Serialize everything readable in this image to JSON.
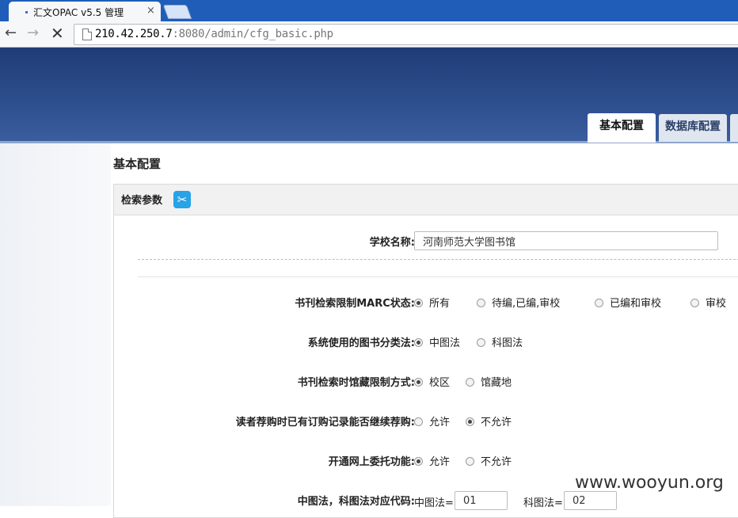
{
  "browser": {
    "tab_title": "汇文OPAC v5.5 管理",
    "close_glyph": "×",
    "nav": {
      "back": "←",
      "forward": "→",
      "stop": "✕"
    },
    "url_host": "210.42.250.7",
    "url_rest": ":8080/admin/cfg_basic.php"
  },
  "page_tabs": {
    "active": "基本配置",
    "inactive": "数据库配置"
  },
  "page_heading": "基本配置",
  "panel": {
    "title": "检索参数",
    "school_name_label": "学校名称:",
    "school_name_value": "河南师范大学图书馆",
    "rows": [
      {
        "label": "书刊检索限制MARC状态:",
        "options": [
          {
            "label": "所有",
            "selected": true
          },
          {
            "label": "待编,已编,审校",
            "selected": false
          },
          {
            "label": "已编和审校",
            "selected": false
          },
          {
            "label": "审校",
            "selected": false
          }
        ]
      },
      {
        "label": "系统使用的图书分类法:",
        "options": [
          {
            "label": "中图法",
            "selected": true
          },
          {
            "label": "科图法",
            "selected": false
          }
        ]
      },
      {
        "label": "书刊检索时馆藏限制方式:",
        "options": [
          {
            "label": "校区",
            "selected": true
          },
          {
            "label": "馆藏地",
            "selected": false
          }
        ]
      },
      {
        "label": "读者荐购时已有订购记录能否继续荐购:",
        "options": [
          {
            "label": "允许",
            "selected": false
          },
          {
            "label": "不允许",
            "selected": true
          }
        ]
      },
      {
        "label": "开通网上委托功能:",
        "options": [
          {
            "label": "允许",
            "selected": true
          },
          {
            "label": "不允许",
            "selected": false
          }
        ]
      }
    ],
    "code_row": {
      "label": "中图法，科图法对应代码:",
      "zt_label": "中图法=",
      "zt_value": "01",
      "kt_label": "科图法=",
      "kt_value": "02"
    }
  },
  "watermark": "www.wooyun.org"
}
